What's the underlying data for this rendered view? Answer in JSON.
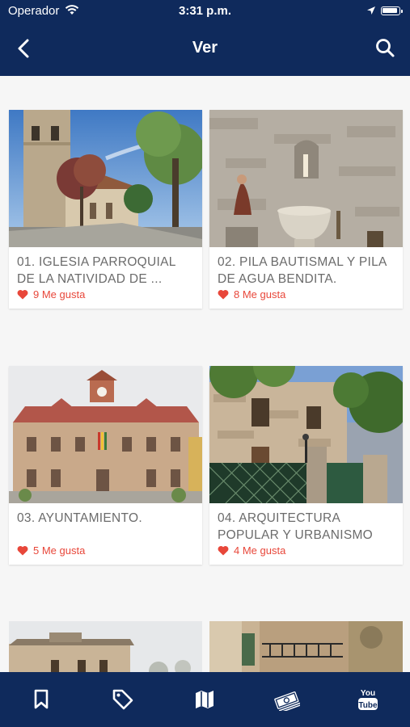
{
  "status_bar": {
    "carrier": "Operador",
    "time": "3:31 p.m."
  },
  "nav": {
    "title": "Ver"
  },
  "items": [
    {
      "name": "01. IGLESIA PARROQUIAL DE LA NATIVIDAD DE ...",
      "likes": "9 Me gusta"
    },
    {
      "name": "02. PILA BAUTISMAL Y PILA DE AGUA BENDITA.",
      "likes": "8 Me gusta"
    },
    {
      "name": "03. AYUNTAMIENTO.",
      "likes": "5 Me gusta"
    },
    {
      "name": "04. ARQUITECTURA POPULAR Y URBANISMO",
      "likes": "4 Me gusta"
    }
  ],
  "tabs": [
    {
      "icon": "bookmark-icon"
    },
    {
      "icon": "tag-icon"
    },
    {
      "icon": "map-icon"
    },
    {
      "icon": "money-icon"
    },
    {
      "icon": "youtube-icon",
      "label_top": "You",
      "label_bottom": "Tube"
    }
  ],
  "colors": {
    "brand": "#0f2a5c",
    "likes": "#e8473a"
  }
}
